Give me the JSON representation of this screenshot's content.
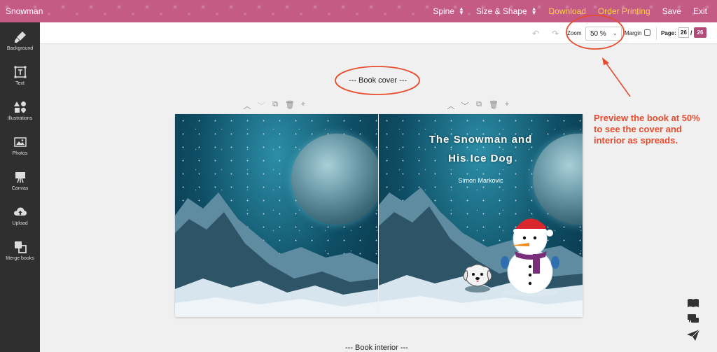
{
  "app": {
    "title": "Snowman"
  },
  "menu": {
    "spine": "Spine",
    "size_shape": "Size & Shape",
    "download": "Download",
    "order_printing": "Order Printing",
    "save": "Save",
    "exit": "Exit"
  },
  "sidebar": {
    "items": [
      {
        "label": "Background",
        "icon": "brush-icon"
      },
      {
        "label": "Text",
        "icon": "text-icon"
      },
      {
        "label": "Illustrations",
        "icon": "shapes-icon"
      },
      {
        "label": "Photos",
        "icon": "photo-icon"
      },
      {
        "label": "Canvas",
        "icon": "easel-icon"
      },
      {
        "label": "Upload",
        "icon": "upload-icon"
      },
      {
        "label": "Merge books",
        "icon": "merge-icon"
      }
    ]
  },
  "toolbar": {
    "zoom_label": "Zoom",
    "zoom_value": "50 %",
    "margin_label": "Margin",
    "page_label": "Page:",
    "page_current": "26",
    "page_separator": "/",
    "page_total": "26"
  },
  "canvas": {
    "book_cover_label": "--- Book cover ---",
    "book_interior_label": "--- Book interior ---",
    "cover_title_line1": "The Snowman and",
    "cover_title_line2": "His Ice Dog",
    "cover_author": "Simon Markovic"
  },
  "annotation": {
    "text": "Preview the book at 50% to see the cover and interior as spreads."
  },
  "colors": {
    "topbar": "#c45a86",
    "highlight": "#ffcf4a",
    "sidebar": "#2f2f2f",
    "annotation": "#e94b2e"
  }
}
